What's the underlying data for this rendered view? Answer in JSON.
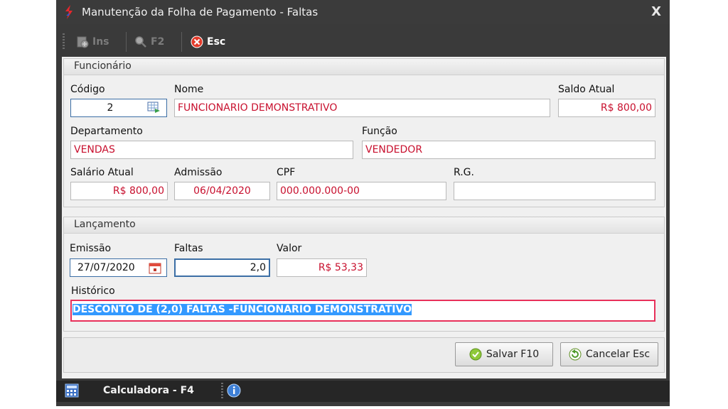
{
  "window": {
    "title": "Manutenção da Folha de Pagamento - Faltas",
    "close": "X"
  },
  "toolbar": {
    "ins": "Ins",
    "f2": "F2",
    "esc": "Esc"
  },
  "funcionario": {
    "section_title": "Funcionário",
    "codigo_label": "Código",
    "codigo": "2",
    "nome_label": "Nome",
    "nome": "FUNCIONARIO DEMONSTRATIVO",
    "saldo_label": "Saldo Atual",
    "saldo": "R$ 800,00",
    "departamento_label": "Departamento",
    "departamento": "VENDAS",
    "funcao_label": "Função",
    "funcao": "VENDEDOR",
    "salario_label": "Salário Atual",
    "salario": "R$ 800,00",
    "admissao_label": "Admissão",
    "admissao": "06/04/2020",
    "cpf_label": "CPF",
    "cpf": "000.000.000-00",
    "rg_label": "R.G.",
    "rg": ""
  },
  "lancamento": {
    "section_title": "Lançamento",
    "emissao_label": "Emissão",
    "emissao": "27/07/2020",
    "faltas_label": "Faltas",
    "faltas": "2,0",
    "valor_label": "Valor",
    "valor": "R$ 53,33",
    "historico_label": "Histórico",
    "historico": "DESCONTO DE (2,0) FALTAS -FUNCIONARIO DEMONSTRATIVO"
  },
  "actions": {
    "salvar": "Salvar F10",
    "cancelar": "Cancelar Esc"
  },
  "statusbar": {
    "calculadora": "Calculadora - F4"
  },
  "colors": {
    "value_text": "#c8102e",
    "selection": "#3399ff",
    "accent_border": "#e8305a"
  }
}
